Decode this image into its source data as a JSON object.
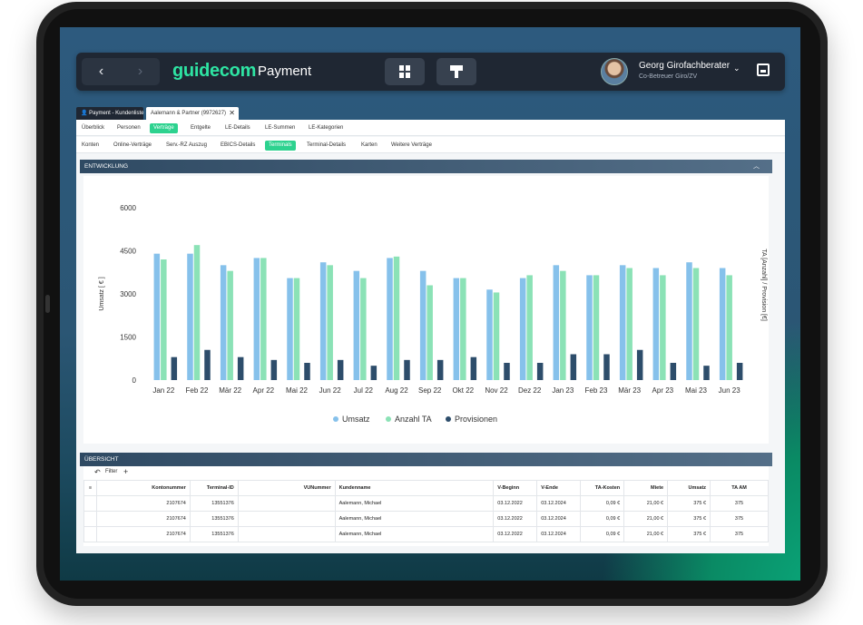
{
  "header": {
    "back_icon": "chevron-left",
    "forward_icon": "chevron-right",
    "logo_text": "guidecom",
    "app_title": "Payment",
    "user_name": "Georg Girofachberater",
    "user_role": "Co-Betreuer Giro/ZV"
  },
  "tabs": [
    {
      "label": "Payment - Kundenliste",
      "icon": "user-icon"
    },
    {
      "label": "Aalemann & Partner (9972627)",
      "icon": "close-icon"
    }
  ],
  "nav_primary": [
    "Überblick",
    "Personen",
    "Verträge",
    "Entgelte",
    "LE-Details",
    "LE-Summen",
    "LE-Kategorien"
  ],
  "nav_primary_active": "Verträge",
  "nav_secondary": [
    "Konten",
    "Online-Verträge",
    "Serv.-RZ Auszug",
    "EBICS-Details",
    "Terminals",
    "Terminal-Details",
    "Karten",
    "Weitere Verträge"
  ],
  "nav_secondary_active": "Terminals",
  "sections": {
    "development": "ENTWICKLUNG",
    "overview": "ÜBERSICHT"
  },
  "filter": {
    "label": "Filter"
  },
  "colors": {
    "umsatz": "#86c1eb",
    "anzahl": "#8be2b6",
    "provisionen": "#2d4d6b",
    "accent": "#2dd28f"
  },
  "chart_data": {
    "type": "bar",
    "categories": [
      "Jan 22",
      "Feb 22",
      "Mär 22",
      "Apr 22",
      "Mai 22",
      "Jun 22",
      "Jul 22",
      "Aug 22",
      "Sep 22",
      "Okt 22",
      "Nov 22",
      "Dez 22",
      "Jan 23",
      "Feb 23",
      "Mär 23",
      "Apr 23",
      "Mai 23",
      "Jun 23"
    ],
    "series": [
      {
        "name": "Umsatz",
        "values": [
          4400,
          4400,
          4000,
          4250,
          3550,
          4100,
          3800,
          4250,
          3800,
          3550,
          3150,
          3550,
          4000,
          3650,
          4000,
          3900,
          4100,
          3900
        ]
      },
      {
        "name": "Anzahl TA",
        "values": [
          4200,
          4700,
          3800,
          4250,
          3550,
          4000,
          3550,
          4300,
          3300,
          3550,
          3050,
          3650,
          3800,
          3650,
          3900,
          3650,
          3900,
          3650
        ]
      },
      {
        "name": "Provisionen",
        "values": [
          800,
          1050,
          800,
          700,
          600,
          700,
          500,
          700,
          700,
          800,
          600,
          600,
          900,
          900,
          1050,
          600,
          500,
          600
        ]
      }
    ],
    "ylabel": "Umsatz [ € ]",
    "ylabel_right": "TA [Anzahl] / Provision [€]",
    "yticks": [
      0,
      1500,
      3000,
      4500,
      6000
    ],
    "ylim": [
      0,
      6000
    ],
    "legend_position": "bottom"
  },
  "table": {
    "columns": [
      "Kontonummer",
      "Terminal-ID",
      "VUNummer",
      "Kundenname",
      "V-Beginn",
      "V-Ende",
      "TA-Kosten",
      "Miete",
      "Umsatz",
      "TA AM"
    ],
    "rows": [
      [
        "2107674",
        "13551376",
        "",
        "Aalemann, Michael",
        "03.12.2022",
        "03.12.2024",
        "0,09 €",
        "21,00 €",
        "375 €",
        "375"
      ],
      [
        "2107674",
        "13551376",
        "",
        "Aalemann, Michael",
        "03.12.2022",
        "03.12.2024",
        "0,09 €",
        "21,00 €",
        "375 €",
        "375"
      ],
      [
        "2107674",
        "13551376",
        "",
        "Aalemann, Michael",
        "03.12.2022",
        "03.12.2024",
        "0,09 €",
        "21,00 €",
        "375 €",
        "375"
      ]
    ]
  }
}
